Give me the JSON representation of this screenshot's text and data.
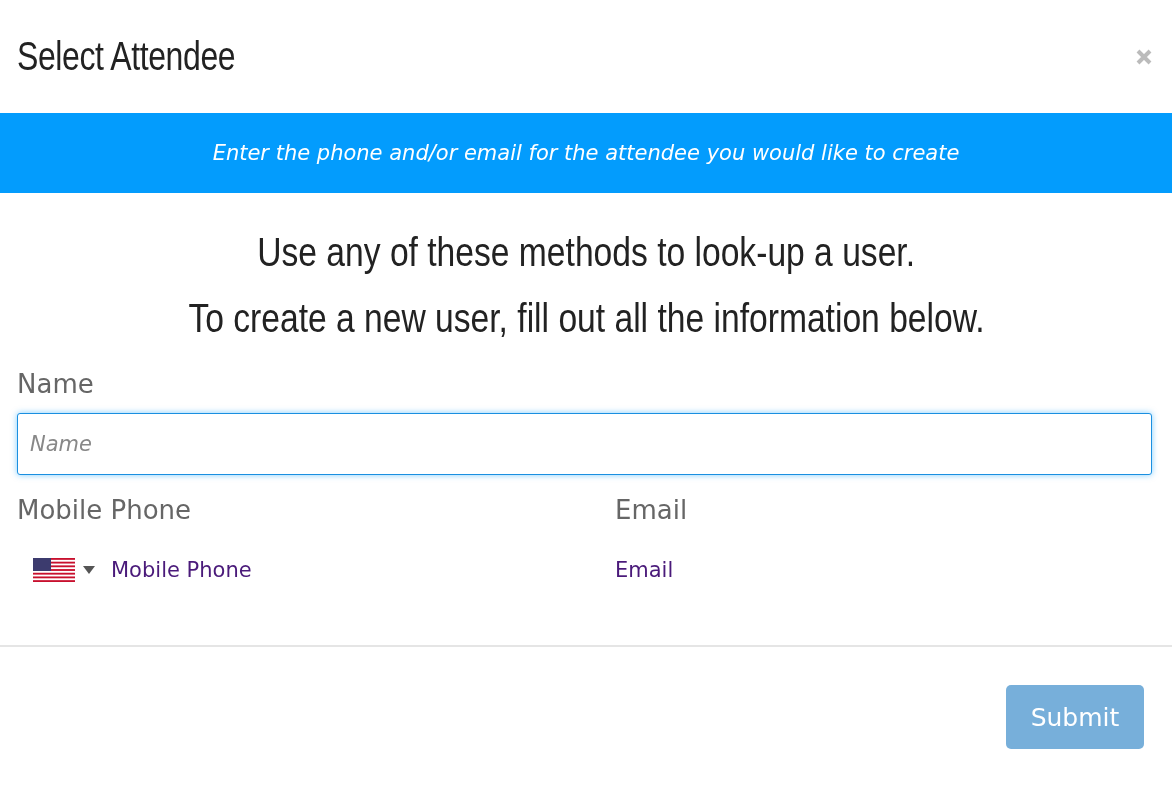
{
  "dialog": {
    "title": "Select Attendee"
  },
  "banner": "Enter the phone and/or email for the attendee you would like to create",
  "instructions": [
    "Use any of these methods to look-up a user.",
    "To create a new user, fill out all the information below."
  ],
  "name_field": {
    "label": "Name",
    "placeholder": "Name",
    "focused": true
  },
  "phone_field": {
    "label": "Mobile Phone",
    "placeholder": "Mobile Phone"
  },
  "email_field": {
    "label": "Email",
    "placeholder": "Email"
  },
  "submit": {
    "label": "Submit",
    "disabled": true
  }
}
